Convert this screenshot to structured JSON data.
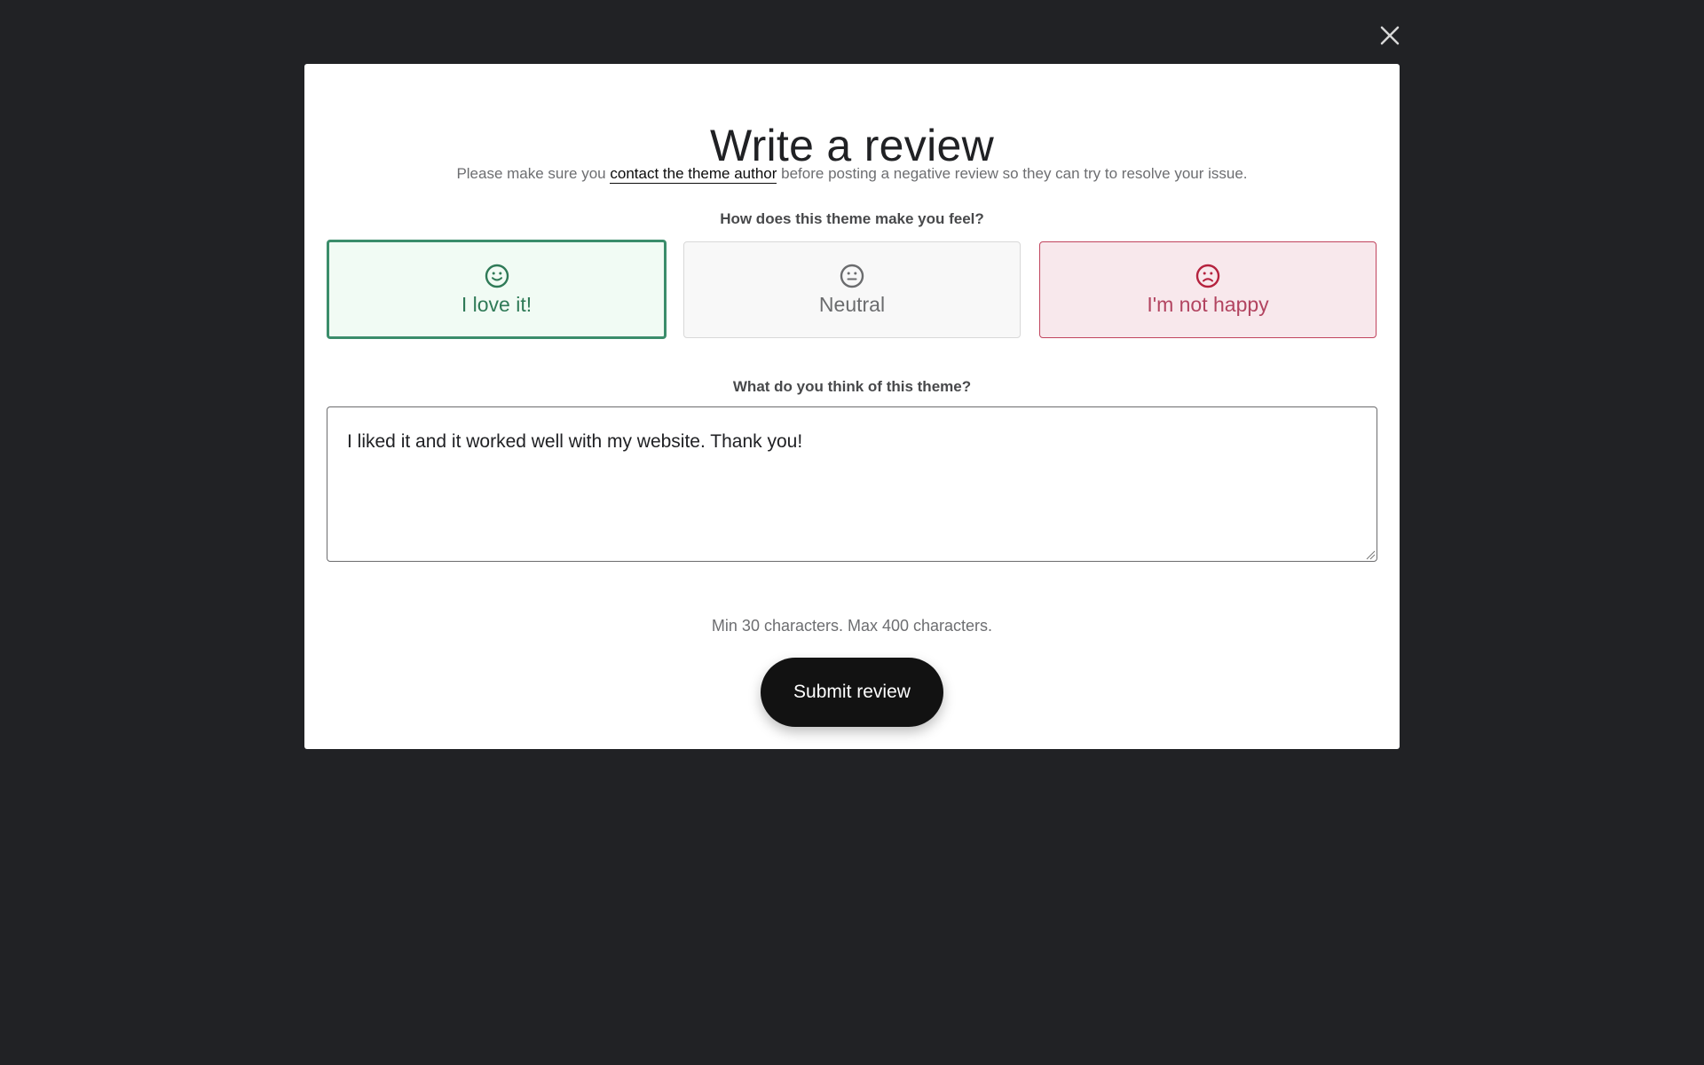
{
  "close": {
    "icon": "close-icon"
  },
  "modal": {
    "title": "Write a review",
    "notice": {
      "before": "Please make sure you ",
      "link": "contact the theme author",
      "after": " before posting a negative review so they can try to resolve your issue."
    },
    "feel_question": "How does this theme make you feel?",
    "options": [
      {
        "label": "I love it!",
        "icon": "smile-icon",
        "selected": true,
        "color": "#2f7a57"
      },
      {
        "label": "Neutral",
        "icon": "neutral-face-icon",
        "selected": false,
        "color": "#6b6c6e"
      },
      {
        "label": "I'm not happy",
        "icon": "frown-icon",
        "selected": false,
        "color": "#b24460"
      }
    ],
    "think_question": "What do you think of this theme?",
    "review_text": "I liked it and it worked well with my website. Thank you!",
    "hint": "Min 30 characters. Max 400 characters.",
    "submit_label": "Submit review"
  },
  "colors": {
    "backdrop": "#212225",
    "accent_positive": "#3b8d6b",
    "accent_negative": "#c1445e",
    "button": "#121212"
  }
}
